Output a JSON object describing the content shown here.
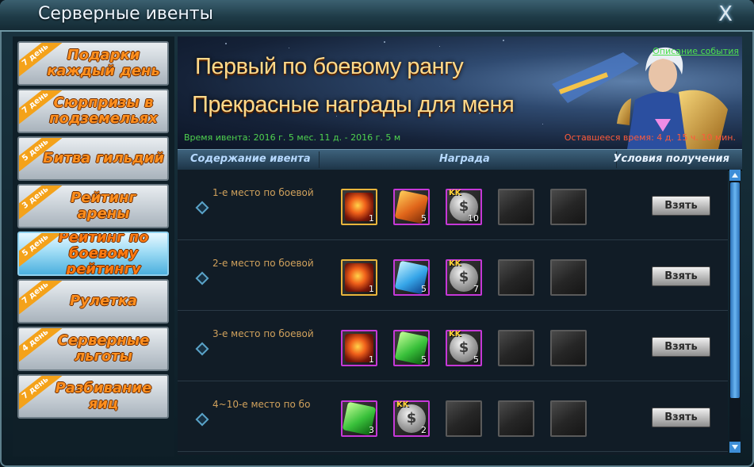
{
  "window": {
    "title": "Серверные ивенты",
    "close_label": "X"
  },
  "sidebar": {
    "items": [
      {
        "badge": "7 день",
        "label": "Подарки каждый день",
        "active": false
      },
      {
        "badge": "7 день",
        "label": "Сюрпризы в подземельях",
        "active": false
      },
      {
        "badge": "5 день",
        "label": "Битва гильдий",
        "active": false
      },
      {
        "badge": "3 день",
        "label": "Рейтинг арены",
        "active": false
      },
      {
        "badge": "5 день",
        "label": "Рейтинг по боевому рейтингу",
        "active": true
      },
      {
        "badge": "7 день",
        "label": "Рулетка",
        "active": false
      },
      {
        "badge": "4 день",
        "label": "Серверные льготы",
        "active": false
      },
      {
        "badge": "7 день",
        "label": "Разбивание яиц",
        "active": false
      }
    ]
  },
  "banner": {
    "line1": "Первый по боевому рангу",
    "line2": "Прекрасные награды для меня",
    "time": "Время ивента: 2016 г. 5 мес. 11 д. - 2016 г. 5 м",
    "remaining": "Оставшееся время: 4 д. 15 ч. 10 мин.",
    "description_link": "Описание события"
  },
  "table": {
    "col_content": "Содержание ивента",
    "col_reward": "Награда",
    "col_conditions": "Условия получения",
    "take_label": "Взять",
    "rows": [
      {
        "name": "1-е место по боевой",
        "rewards": [
          {
            "icon": "flame-figure-icon",
            "frame": "gold",
            "count": "1"
          },
          {
            "icon": "orange-crystal-icon",
            "frame": "purple",
            "count": "5"
          },
          {
            "icon": "coin-icon",
            "frame": "purple",
            "count": "10"
          },
          {
            "icon": "empty",
            "frame": "empty",
            "count": ""
          },
          {
            "icon": "empty",
            "frame": "empty",
            "count": ""
          }
        ]
      },
      {
        "name": "2-е место по боевой",
        "rewards": [
          {
            "icon": "flame-figure-icon",
            "frame": "gold",
            "count": "1"
          },
          {
            "icon": "blue-crystal-icon",
            "frame": "purple",
            "count": "5"
          },
          {
            "icon": "coin-icon",
            "frame": "purple",
            "count": "7"
          },
          {
            "icon": "empty",
            "frame": "empty",
            "count": ""
          },
          {
            "icon": "empty",
            "frame": "empty",
            "count": ""
          }
        ]
      },
      {
        "name": "3-е место по боевой",
        "rewards": [
          {
            "icon": "flame-figure-icon",
            "frame": "purple",
            "count": "1"
          },
          {
            "icon": "green-crystal-icon",
            "frame": "purple",
            "count": "5"
          },
          {
            "icon": "coin-icon",
            "frame": "purple",
            "count": "5"
          },
          {
            "icon": "empty",
            "frame": "empty",
            "count": ""
          },
          {
            "icon": "empty",
            "frame": "empty",
            "count": ""
          }
        ]
      },
      {
        "name": "4~10-е место по бо",
        "rewards": [
          {
            "icon": "green-crystal-icon",
            "frame": "purple",
            "count": "3"
          },
          {
            "icon": "coin-icon",
            "frame": "purple",
            "count": "2"
          },
          {
            "icon": "empty",
            "frame": "empty",
            "count": ""
          },
          {
            "icon": "empty",
            "frame": "empty",
            "count": ""
          },
          {
            "icon": "empty",
            "frame": "empty",
            "count": ""
          }
        ]
      }
    ]
  },
  "colors": {
    "accent_orange": "#ff8f1e",
    "banner_gold": "#ffd98a",
    "time_green": "#4fd24f",
    "remain_red": "#ff5a3a"
  }
}
